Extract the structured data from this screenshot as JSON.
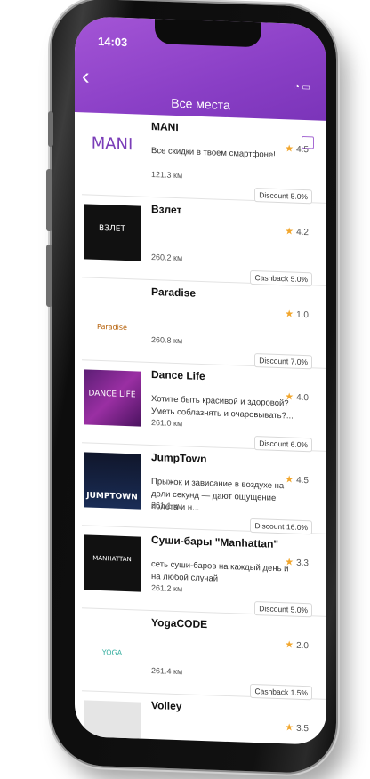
{
  "status_bar": {
    "time": "14:03"
  },
  "nav": {
    "title": "Все места"
  },
  "places": [
    {
      "name": "MANI",
      "logo_text": "MANI",
      "desc": "Все скидки в твоем смартфоне!",
      "distance": "121.3 км",
      "rating": "4.5",
      "badge": "Discount 5.0%"
    },
    {
      "name": "Взлет",
      "logo_text": "ВЗЛЕТ",
      "desc": "",
      "distance": "260.2 км",
      "rating": "4.2",
      "badge": "Cashback 5.0%"
    },
    {
      "name": "Paradise",
      "logo_text": "Paradise",
      "desc": "",
      "distance": "260.8 км",
      "rating": "1.0",
      "badge": "Discount 7.0%"
    },
    {
      "name": "Dance Life",
      "logo_text": "DANCE LIFE",
      "desc": "Хотите быть красивой и здоровой? Уметь соблазнять и очаровывать?...",
      "distance": "261.0 км",
      "rating": "4.0",
      "badge": "Discount 6.0%"
    },
    {
      "name": "JumpTown",
      "logo_text": "JUMPTOWN",
      "desc": "Прыжок и зависание в воздухе на доли секунд — дают ощущение полета и н...",
      "distance": "261.1 км",
      "rating": "4.5",
      "badge": "Discount 16.0%"
    },
    {
      "name": "Суши-бары \"Manhattan\"",
      "logo_text": "MANHATTAN",
      "desc": "сеть суши-баров на каждый день и на любой случай",
      "distance": "261.2 км",
      "rating": "3.3",
      "badge": "Discount 5.0%"
    },
    {
      "name": "YogaCODE",
      "logo_text": "YOGA",
      "desc": "",
      "distance": "261.4 км",
      "rating": "2.0",
      "badge": "Cashback 1.5%"
    },
    {
      "name": "Volley",
      "logo_text": "",
      "desc": "",
      "distance": "",
      "rating": "3.5",
      "badge": ""
    }
  ],
  "colors": {
    "accent": "#8a3fc6",
    "star": "#f2a62c"
  }
}
